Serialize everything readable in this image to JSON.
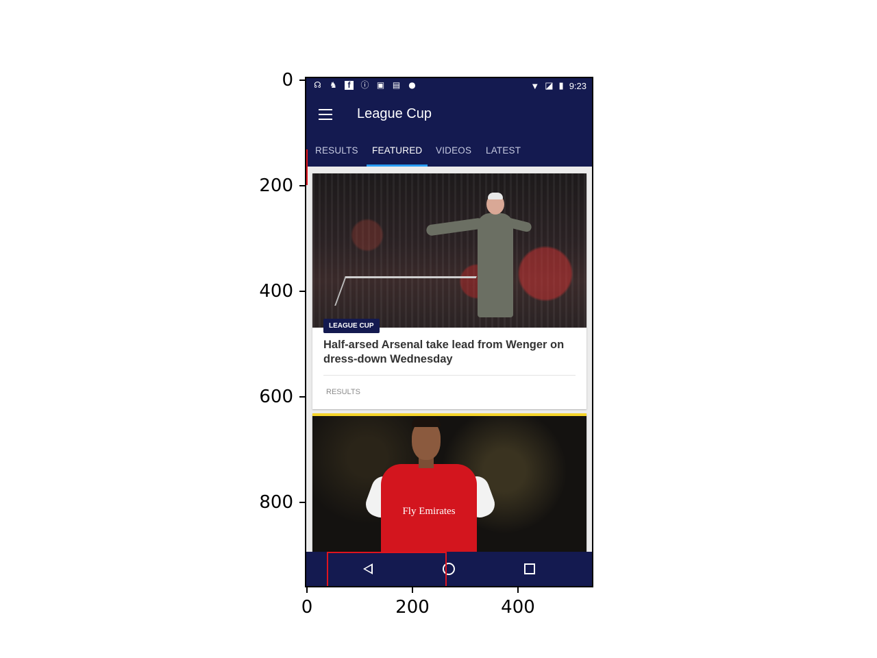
{
  "axes": {
    "y_ticks": [
      "0",
      "200",
      "400",
      "600",
      "800"
    ],
    "x_ticks": [
      "0",
      "200",
      "400"
    ]
  },
  "status_bar": {
    "time": "9:23",
    "left_icons": [
      "headset-icon",
      "fox-icon",
      "facebook-icon",
      "info-icon",
      "lock-icon",
      "briefcase-icon",
      "android-icon"
    ],
    "right_icons": [
      "wifi-icon",
      "no-sim-icon",
      "battery-icon"
    ]
  },
  "toolbar": {
    "title": "League Cup",
    "menu_icon": "hamburger-menu-icon"
  },
  "tabs": {
    "items": [
      {
        "label": "RESULTS"
      },
      {
        "label": "FEATURED"
      },
      {
        "label": "VIDEOS"
      },
      {
        "label": "LATEST"
      }
    ],
    "active": "FEATURED",
    "accent_color": "#2a9df4"
  },
  "articles": [
    {
      "badge": "LEAGUE CUP",
      "headline": "Half-arsed Arsenal take lead from Wenger on dress-down Wednesday",
      "category": "RESULTS"
    },
    {
      "sponsor_text": "Fly Emirates",
      "accent_color": "#f5d42a"
    }
  ],
  "nav_bar": {
    "buttons": [
      "back-icon",
      "home-icon",
      "recent-apps-icon"
    ]
  },
  "colors": {
    "primary": "#141a50",
    "highlight": "#e0141e"
  }
}
